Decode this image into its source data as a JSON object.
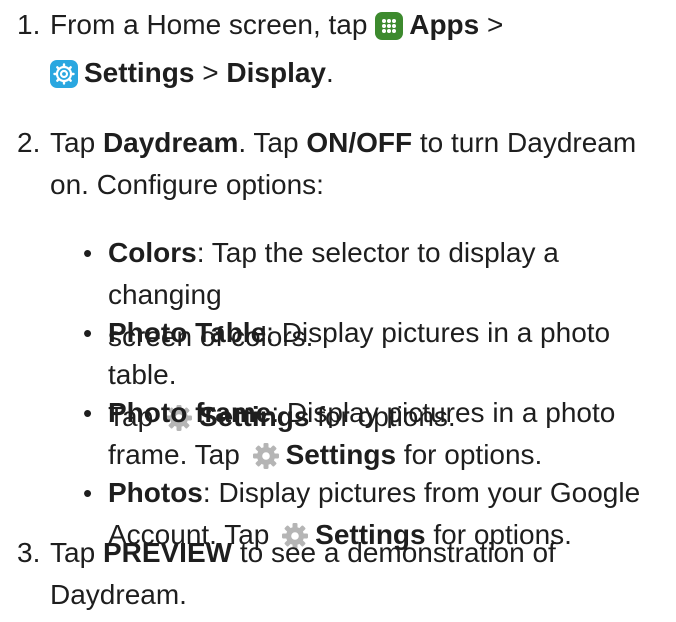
{
  "steps": [
    {
      "number": "1.",
      "text_1": "From a Home screen, tap ",
      "apps_label": "Apps",
      "sep_1": " >",
      "settings_label": "Settings",
      "sep_2": " > ",
      "display_label": "Display",
      "end": "."
    },
    {
      "number": "2.",
      "text_1": "Tap ",
      "daydream_label": "Daydream",
      "text_2": ". Tap ",
      "onoff_label": "ON/OFF",
      "text_3": " to turn Daydream",
      "line_2": "on. Configure options:",
      "bullets": [
        {
          "title": "Colors",
          "line_1": ": Tap the selector to display a changing",
          "line_2": "screen of colors."
        },
        {
          "title": "Photo Table",
          "line_1": ": Display pictures in a photo table.",
          "tap": "Tap ",
          "settings_label": "Settings",
          "after": " for options."
        },
        {
          "title": "Photo frame",
          "line_1": ": Display pictures in a photo",
          "tap": "frame. Tap ",
          "settings_label": "Settings",
          "after": " for options."
        },
        {
          "title": "Photos",
          "line_1": ": Display pictures from your Google",
          "tap": "Account. Tap ",
          "settings_label": "Settings",
          "after": " for options."
        }
      ]
    },
    {
      "number": "3.",
      "text_1": "Tap ",
      "preview_label": "PREVIEW",
      "text_2": " to see a demonstration of",
      "line_2": "Daydream."
    }
  ],
  "icons": {
    "apps": "apps-grid-icon",
    "settings_app": "settings-app-icon",
    "gear": "gear-icon",
    "apps_color": "#3d8a2e",
    "settings_color": "#2aa7e0",
    "gear_color": "#b5b5b5"
  },
  "bullet_char": "•"
}
